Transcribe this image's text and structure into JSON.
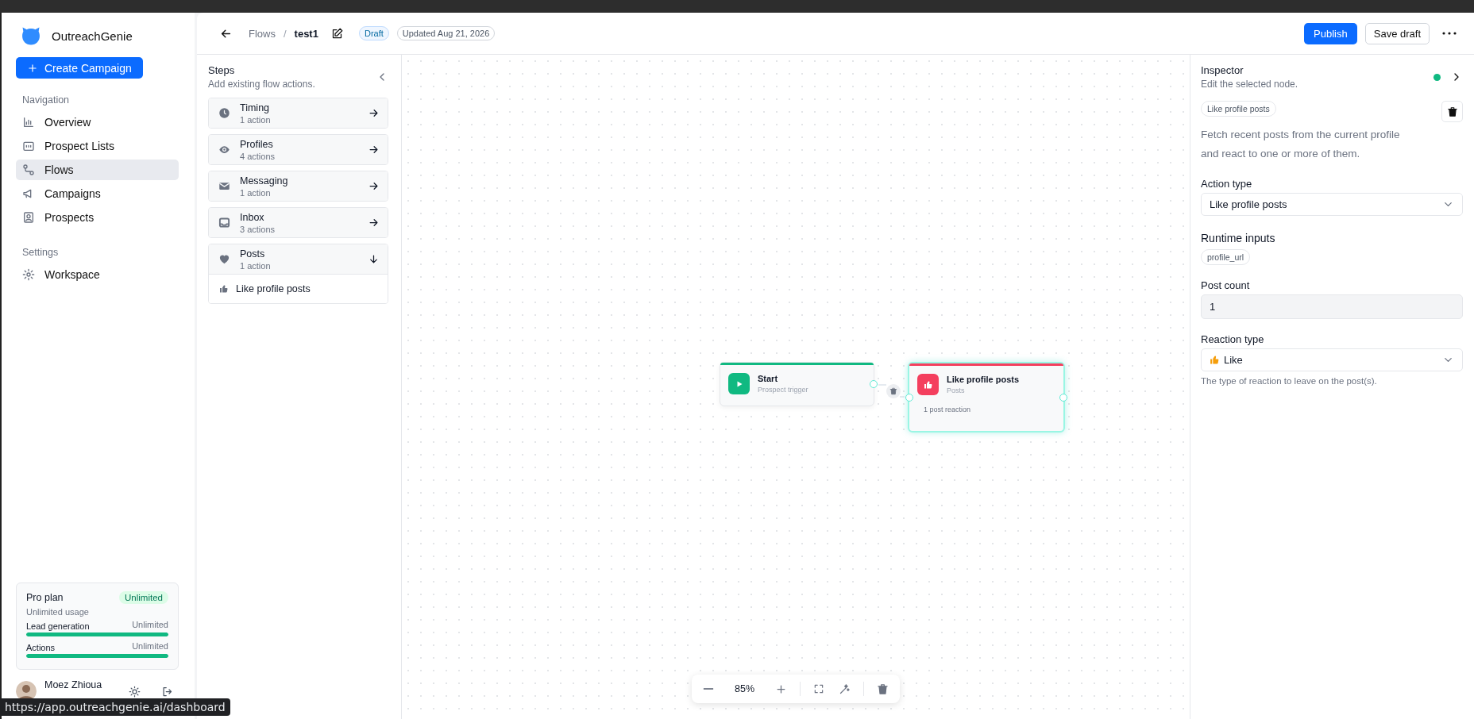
{
  "sidebar": {
    "app_name": "OutreachGenie",
    "create_button": "Create Campaign",
    "sections": [
      {
        "title": "Navigation",
        "items": [
          {
            "label": "Overview",
            "selected": false
          },
          {
            "label": "Prospect Lists",
            "selected": false
          },
          {
            "label": "Flows",
            "selected": true
          },
          {
            "label": "Campaigns",
            "selected": false
          },
          {
            "label": "Prospects",
            "selected": false
          }
        ]
      },
      {
        "title": "Settings",
        "items": [
          {
            "label": "Workspace",
            "selected": false
          }
        ]
      }
    ],
    "plan": {
      "name": "Pro plan",
      "badge": "Unlimited",
      "usage": "Unlimited usage",
      "meters": [
        {
          "label": "Lead generation",
          "reading": "Unlimited",
          "level": 1
        },
        {
          "label": "Actions",
          "reading": "Unlimited",
          "level": 1
        }
      ]
    },
    "user": {
      "name": "Moez Zhioua"
    }
  },
  "header": {
    "breadcrumb": {
      "parent": "Flows",
      "separator": "/",
      "current": "test1"
    },
    "status": "Draft",
    "updated": "Updated Aug 21, 2026",
    "buttons": [
      {
        "label": "Publish",
        "kind": "primary"
      },
      {
        "label": "Save draft",
        "kind": "secondary"
      }
    ]
  },
  "steps": {
    "title": "Steps",
    "subtitle": "Add existing flow actions.",
    "groups": [
      {
        "name": "Timing",
        "count": "1 action",
        "expanded": false
      },
      {
        "name": "Profiles",
        "count": "4 actions",
        "expanded": false
      },
      {
        "name": "Messaging",
        "count": "1 action",
        "expanded": false
      },
      {
        "name": "Inbox",
        "count": "3 actions",
        "expanded": false
      },
      {
        "name": "Posts",
        "count": "1 action",
        "expanded": true,
        "children": [
          {
            "label": "Like profile posts"
          }
        ]
      }
    ]
  },
  "canvas": {
    "nodes": [
      {
        "title": "Start",
        "subtitle": "Prospect trigger",
        "color": "#10b981",
        "selected": false
      },
      {
        "title": "Like profile posts",
        "subtitle": "Posts",
        "detail": "1 post reaction",
        "color": "#f43f5e",
        "selected": true
      }
    ],
    "zoom": "85%"
  },
  "inspector": {
    "title": "Inspector",
    "subtitle": "Edit the selected node.",
    "tag": "Like profile posts",
    "description": "Fetch recent posts from the current profile and react to one or more of them.",
    "fields": [
      {
        "kind": "select",
        "label": "Action type",
        "value": "Like profile posts"
      },
      {
        "kind": "chips",
        "label": "Runtime inputs",
        "chips": [
          "profile_url"
        ]
      },
      {
        "kind": "input",
        "label": "Post count",
        "value": "1"
      },
      {
        "kind": "select",
        "label": "Reaction type",
        "value": "Like",
        "help": "The type of reaction to leave on the post(s)."
      }
    ]
  },
  "browser_status": {
    "url": "https://app.outreachgenie.ai/dashboard"
  }
}
